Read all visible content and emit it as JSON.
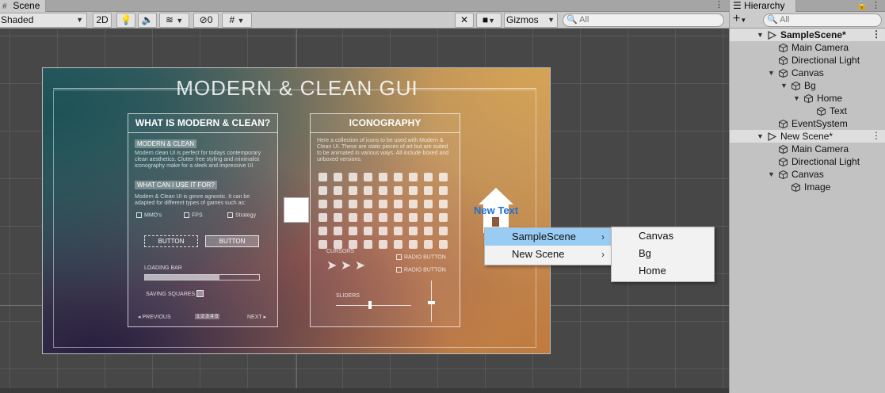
{
  "scene_panel": {
    "tab_label": "Scene",
    "draw_mode": "Shaded",
    "btn_2d": "2D",
    "hidden_count": "0",
    "gizmos_label": "Gizmos",
    "search_placeholder": "All"
  },
  "canvas_gui": {
    "title": "MODERN & CLEAN GUI",
    "left_panel": {
      "title": "WHAT IS MODERN & CLEAN?",
      "subhead1": "MODERN & CLEAN",
      "para1": "Modern clean UI is perfect for todays contemporary clean aesthetics. Clutter free styling and minimalist iconography make for a sleek and impressive UI.",
      "subhead2": "WHAT CAN I USE IT FOR?",
      "para2": "Modern & Clean UI is genre agnostic. It can be adapted for different types of games such as:",
      "checks": [
        "MMO's",
        "FPS",
        "Strategy"
      ],
      "button1": "BUTTON",
      "button2": "BUTTON",
      "loading_label": "LOADING BAR",
      "loading_fraction": 0.65,
      "saving_label": "SAVING SQUARES",
      "prev_label": "PREVIOUS",
      "pages": "1 2 3 4 5",
      "next_label": "NEXT"
    },
    "right_panel": {
      "title": "ICONOGRAPHY",
      "para": "Here a collection of icons to be used with Modern & Clean UI. These are static pieces of art but are suited to be animated in various ways. All include boxed and unboxed versions.",
      "cursors_label": "CURSORS",
      "radio1": "RADIO BUTTON",
      "radio2": "RADIO BUTTON",
      "sliders_label": "SLIDERS"
    }
  },
  "scene_overlay": {
    "new_text": "New Text"
  },
  "context_menu": {
    "items": [
      "SampleScene",
      "New Scene"
    ],
    "submenu": [
      "Canvas",
      "Bg",
      "Home"
    ]
  },
  "hierarchy": {
    "tab_label": "Hierarchy",
    "add_label": "+",
    "search_placeholder": "All",
    "rows": [
      {
        "label": "SampleScene*"
      },
      {
        "label": "Main Camera"
      },
      {
        "label": "Directional Light"
      },
      {
        "label": "Canvas"
      },
      {
        "label": "Bg"
      },
      {
        "label": "Home"
      },
      {
        "label": "Text"
      },
      {
        "label": "EventSystem"
      },
      {
        "label": "New Scene*"
      },
      {
        "label": "Main Camera"
      },
      {
        "label": "Directional Light"
      },
      {
        "label": "Canvas"
      },
      {
        "label": "Image"
      }
    ]
  },
  "colors": {
    "selection": "#99ccf3",
    "new_text": "#1e72d4",
    "viewport_bg": "#474747"
  }
}
